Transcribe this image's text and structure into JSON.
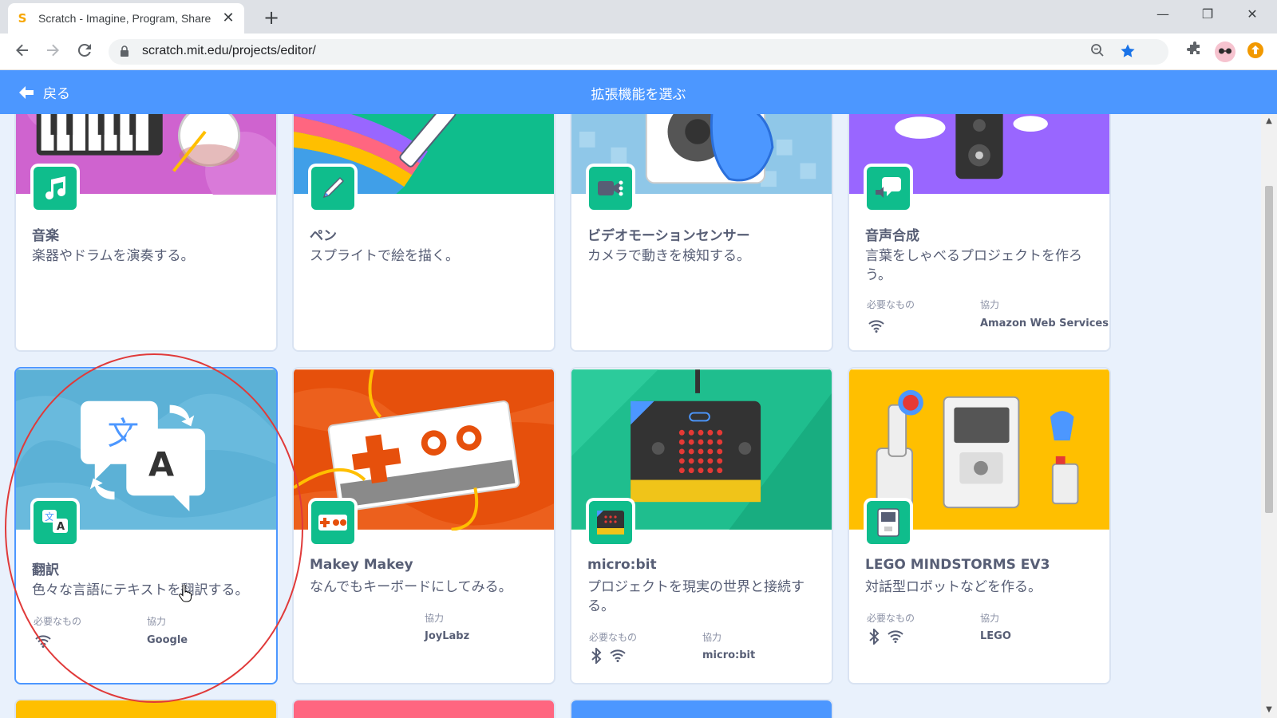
{
  "browser": {
    "tab_title": "Scratch - Imagine, Program, Share",
    "tab_favicon": "S",
    "tab_close": "✕",
    "new_tab": "+",
    "url": "scratch.mit.edu/projects/editor/",
    "window_minimize": "—",
    "window_restore": "❐",
    "window_close": "✕"
  },
  "header": {
    "back_label": "戻る",
    "title": "拡張機能を選ぶ",
    "color": "#4c97ff"
  },
  "labels": {
    "requires": "必要なもの",
    "collaboration": "協力"
  },
  "cards": {
    "music": {
      "name": "音楽",
      "desc": "楽器やドラムを演奏する。",
      "icon": "music-note-icon"
    },
    "pen": {
      "name": "ペン",
      "desc": "スプライトで絵を描く。",
      "icon": "pen-icon"
    },
    "video": {
      "name": "ビデオモーションセンサー",
      "desc": "カメラで動きを検知する。",
      "icon": "video-camera-icon"
    },
    "tts": {
      "name": "音声合成",
      "desc": "言葉をしゃべるプロジェクトを作ろう。",
      "collaborator": "Amazon Web Services",
      "icon": "speech-bubble-icon"
    },
    "translate": {
      "name": "翻訳",
      "desc": "色々な言語にテキストを翻訳する。",
      "collaborator": "Google",
      "icon": "translate-icon"
    },
    "makey": {
      "name": "Makey Makey",
      "desc": "なんでもキーボードにしてみる。",
      "collaborator": "JoyLabz",
      "icon": "makey-makey-icon"
    },
    "microbit": {
      "name": "micro:bit",
      "desc": "プロジェクトを現実の世界と接続する。",
      "collaborator": "micro:bit",
      "icon": "microbit-icon"
    },
    "ev3": {
      "name": "LEGO MINDSTORMS EV3",
      "desc": "対話型ロボットなどを作る。",
      "collaborator": "LEGO",
      "icon": "ev3-icon"
    }
  },
  "colors": {
    "accent": "#4c97ff",
    "extension_green": "#0fbd8c",
    "annotation_red": "#e03a3a"
  }
}
